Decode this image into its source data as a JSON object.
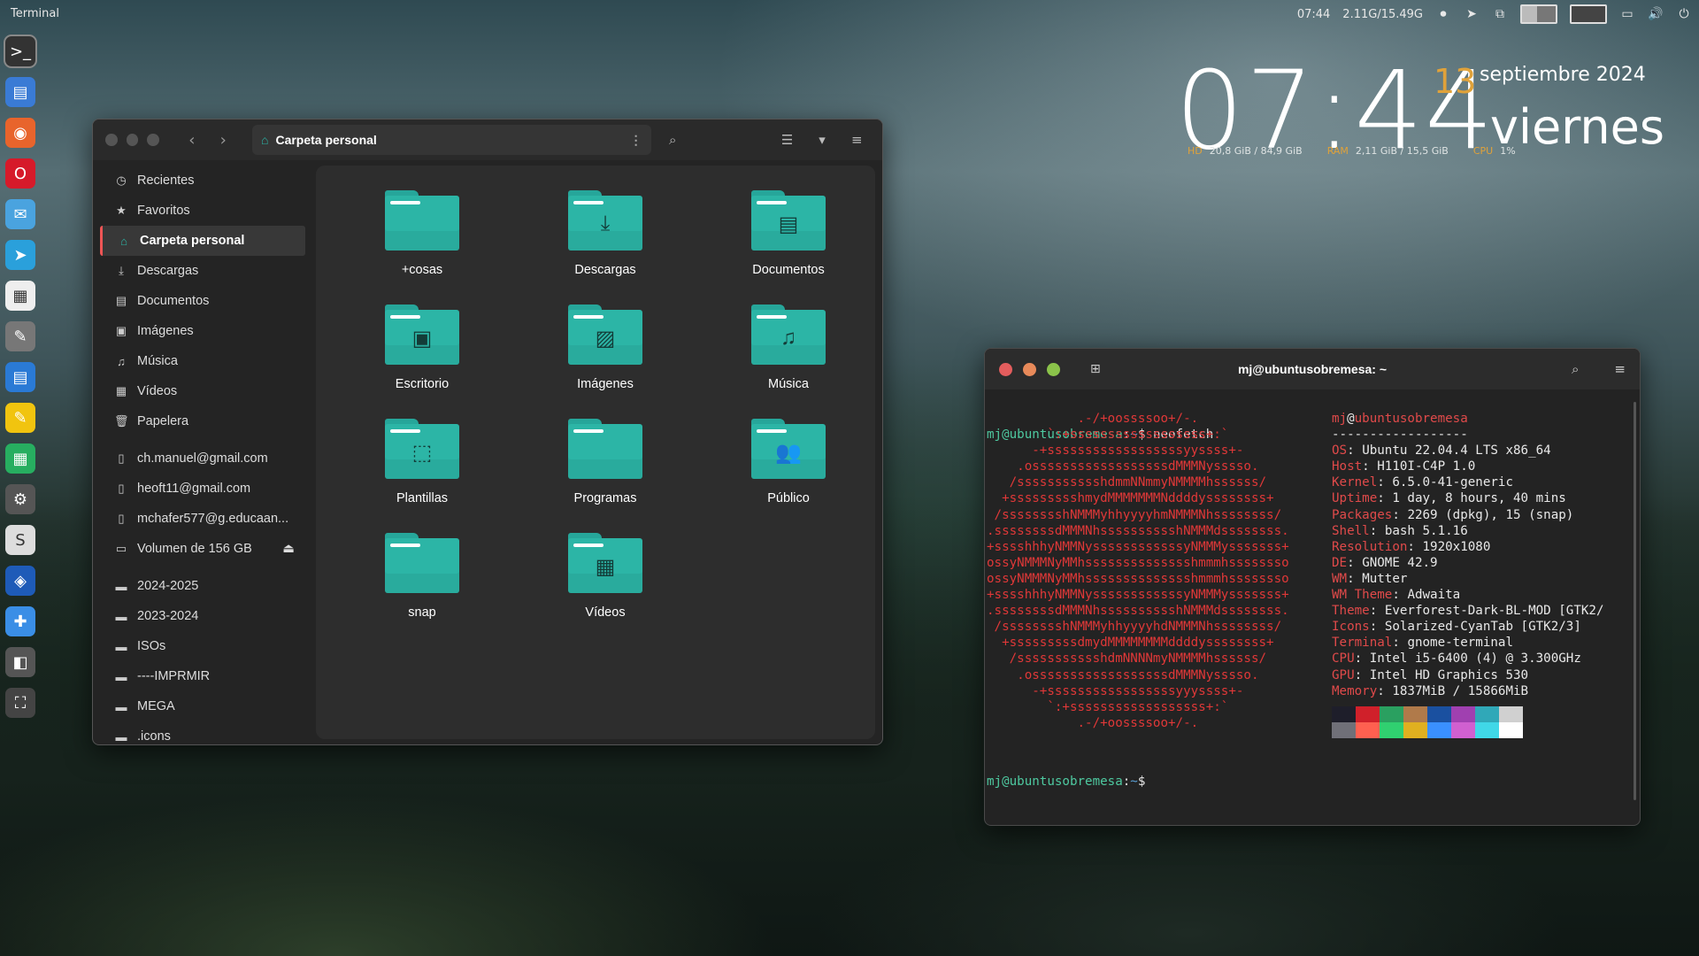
{
  "topbar": {
    "app": "Terminal",
    "time": "07:44",
    "mem": "2.11G/15.49G"
  },
  "conky": {
    "time": "07:44",
    "day": "13",
    "month": "septiembre 2024",
    "weekday": "viernes",
    "stats": [
      {
        "label": "HD",
        "value": "20,8 GiB / 84,9 GiB"
      },
      {
        "label": "RAM",
        "value": "2,11 GiB / 15,5 GiB"
      },
      {
        "label": "CPU",
        "value": "1%"
      }
    ]
  },
  "colors": {
    "accent": "#2cb5a6",
    "red": "#e04a4a",
    "green": "#4ec9a0",
    "orange": "#e0a23a"
  },
  "files": {
    "path": "Carpeta personal",
    "sidebar": [
      {
        "label": "Recientes",
        "icon": "clock-icon",
        "g": "◷"
      },
      {
        "label": "Favoritos",
        "icon": "star-icon",
        "g": "★"
      },
      {
        "label": "Carpeta personal",
        "icon": "home-icon",
        "g": "⌂",
        "sel": true
      },
      {
        "label": "Descargas",
        "icon": "download-icon",
        "g": "⤓"
      },
      {
        "label": "Documentos",
        "icon": "document-icon",
        "g": "▤"
      },
      {
        "label": "Imágenes",
        "icon": "image-icon",
        "g": "▣"
      },
      {
        "label": "Música",
        "icon": "music-icon",
        "g": "♫"
      },
      {
        "label": "Vídeos",
        "icon": "video-icon",
        "g": "▦"
      },
      {
        "label": "Papelera",
        "icon": "trash-icon",
        "g": "🗑"
      },
      {
        "label": "ch.manuel@gmail.com",
        "icon": "drive-icon",
        "g": "▯",
        "gap": true
      },
      {
        "label": "heoft11@gmail.com",
        "icon": "drive-icon",
        "g": "▯"
      },
      {
        "label": "mchafer577@g.educaan...",
        "icon": "drive-icon",
        "g": "▯"
      },
      {
        "label": "Volumen de 156 GB",
        "icon": "disk-icon",
        "g": "▭",
        "eject": "⏏"
      },
      {
        "label": "2024-2025",
        "icon": "folder-icon",
        "g": "▬",
        "gap": true
      },
      {
        "label": "2023-2024",
        "icon": "folder-icon",
        "g": "▬"
      },
      {
        "label": "ISOs",
        "icon": "folder-icon",
        "g": "▬"
      },
      {
        "label": "----IMPRMIR",
        "icon": "folder-icon",
        "g": "▬"
      },
      {
        "label": "MEGA",
        "icon": "folder-icon",
        "g": "▬"
      },
      {
        "label": ".icons",
        "icon": "folder-icon",
        "g": "▬"
      }
    ],
    "items": [
      {
        "label": "+cosas",
        "emb": ""
      },
      {
        "label": "Descargas",
        "emb": "⤓"
      },
      {
        "label": "Documentos",
        "emb": "▤"
      },
      {
        "label": "Escritorio",
        "emb": "▣"
      },
      {
        "label": "Imágenes",
        "emb": "▨"
      },
      {
        "label": "Música",
        "emb": "♫"
      },
      {
        "label": "Plantillas",
        "emb": "⬚"
      },
      {
        "label": "Programas",
        "emb": ""
      },
      {
        "label": "Público",
        "emb": "👥"
      },
      {
        "label": "snap",
        "emb": ""
      },
      {
        "label": "Vídeos",
        "emb": "▦"
      }
    ]
  },
  "terminal": {
    "title": "mj@ubuntusobremesa: ~",
    "user": "mj@ubuntusobremesa",
    "cmd": "neofetch",
    "ascii": [
      "            .-/+oossssoo+/-.",
      "        `:+ssssssssssssssssss+:`",
      "      -+ssssssssssssssssssyyssss+-",
      "    .ossssssssssssssssssdMMMNysssso.",
      "   /ssssssssssshdmmNNmmyNMMMMhssssss/",
      "  +ssssssssshmydMMMMMMMNddddyssssssss+",
      " /sssssssshNMMMyhhyyyyhmNMMMNhssssssss/",
      ".ssssssssdMMMNhsssssssssshNMMMdssssssss.",
      "+sssshhhyNMMNyssssssssssssyNMMMysssssss+",
      "ossyNMMMNyMMhsssssssssssssshmmmhssssssso",
      "ossyNMMMNyMMhsssssssssssssshmmmhssssssso",
      "+sssshhhyNMMNyssssssssssssyNMMMysssssss+",
      ".ssssssssdMMMNhsssssssssshNMMMdssssssss.",
      " /sssssssshNMMMyhhyyyyhdNMMMNhssssssss/",
      "  +sssssssssdmydMMMMMMMMddddyssssssss+",
      "   /ssssssssssshdmNNNNmyNMMMMhssssss/",
      "    .ossssssssssssssssssdMMMNysssso.",
      "      -+sssssssssssssssssyyyssss+-",
      "        `:+ssssssssssssssssss+:`",
      "            .-/+oossssoo+/-."
    ],
    "host": "mj@ubuntusobremesa",
    "sep": "------------------",
    "info": [
      {
        "k": "OS",
        "v": "Ubuntu 22.04.4 LTS x86_64"
      },
      {
        "k": "Host",
        "v": "H110I-C4P 1.0"
      },
      {
        "k": "Kernel",
        "v": "6.5.0-41-generic"
      },
      {
        "k": "Uptime",
        "v": "1 day, 8 hours, 40 mins"
      },
      {
        "k": "Packages",
        "v": "2269 (dpkg), 15 (snap)"
      },
      {
        "k": "Shell",
        "v": "bash 5.1.16"
      },
      {
        "k": "Resolution",
        "v": "1920x1080"
      },
      {
        "k": "DE",
        "v": "GNOME 42.9"
      },
      {
        "k": "WM",
        "v": "Mutter"
      },
      {
        "k": "WM Theme",
        "v": "Adwaita"
      },
      {
        "k": "Theme",
        "v": "Everforest-Dark-BL-MOD [GTK2/"
      },
      {
        "k": "Icons",
        "v": "Solarized-CyanTab [GTK2/3]"
      },
      {
        "k": "Terminal",
        "v": "gnome-terminal"
      },
      {
        "k": "CPU",
        "v": "Intel i5-6400 (4) @ 3.300GHz"
      },
      {
        "k": "GPU",
        "v": "Intel HD Graphics 530"
      },
      {
        "k": "Memory",
        "v": "1837MiB / 15866MiB"
      }
    ],
    "swatches": [
      "#1e1e2a",
      "#d0202a",
      "#2aa060",
      "#b07a4a",
      "#1a50a0",
      "#a040b0",
      "#30a8b8",
      "#d0d0d0",
      "#707078",
      "#ff6050",
      "#30d070",
      "#e0b020",
      "#3a90ff",
      "#d060d0",
      "#40d8e8",
      "#ffffff"
    ]
  },
  "dock": [
    {
      "name": "terminal-icon",
      "bg": "#333",
      "g": ">_"
    },
    {
      "name": "files-icon",
      "bg": "#3a7bd5",
      "g": "▤"
    },
    {
      "name": "firefox-icon",
      "bg": "#e8642c",
      "g": "◉"
    },
    {
      "name": "opera-icon",
      "bg": "#d61a2a",
      "g": "O"
    },
    {
      "name": "mail-icon",
      "bg": "#4aa3df",
      "g": "✉"
    },
    {
      "name": "telegram-icon",
      "bg": "#2aa0db",
      "g": "➤"
    },
    {
      "name": "calendar-icon",
      "bg": "#eee",
      "g": "▦"
    },
    {
      "name": "gimp-icon",
      "bg": "#777",
      "g": "✎"
    },
    {
      "name": "writer-icon",
      "bg": "#2a7ad5",
      "g": "▤"
    },
    {
      "name": "notes-icon",
      "bg": "#f1c40f",
      "g": "✎"
    },
    {
      "name": "calc-icon",
      "bg": "#27ae60",
      "g": "▦"
    },
    {
      "name": "settings-icon",
      "bg": "#555",
      "g": "⚙"
    },
    {
      "name": "vscode-icon",
      "bg": "#ddd",
      "g": "S"
    },
    {
      "name": "bitwarden-icon",
      "bg": "#1e5bb8",
      "g": "◈"
    },
    {
      "name": "extensions-icon",
      "bg": "#3a8ee6",
      "g": "✚"
    },
    {
      "name": "virtualbox-icon",
      "bg": "#555",
      "g": "◧"
    },
    {
      "name": "screenshot-icon",
      "bg": "#444",
      "g": "⛶"
    }
  ]
}
